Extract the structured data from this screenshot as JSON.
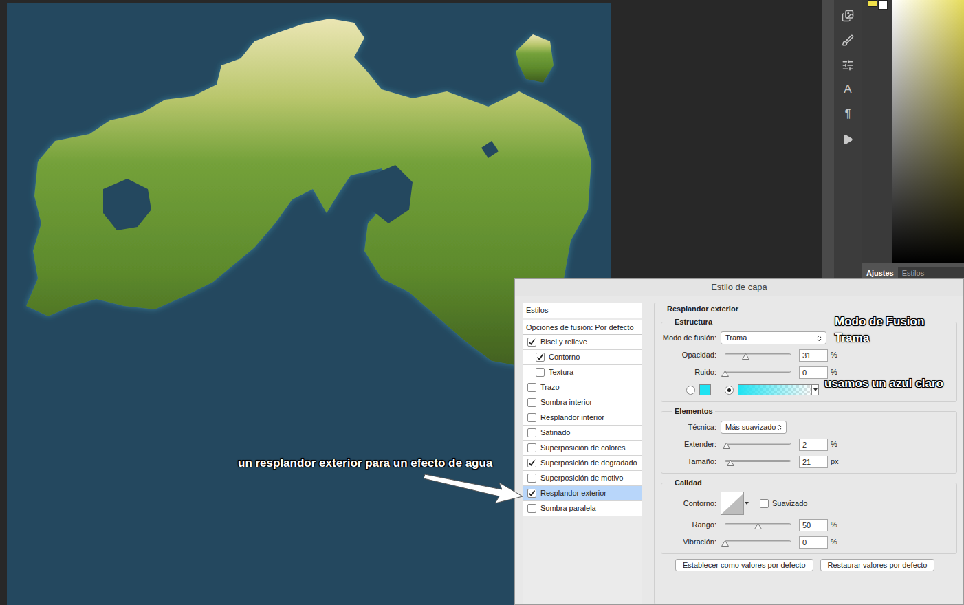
{
  "annotations": {
    "arrow_note": "un resplandor exterior para un efecto de agua",
    "blend_note": [
      "Modo de Fusion",
      "Trama"
    ],
    "color_note": "usamos un azul claro"
  },
  "tools": [
    {
      "kind": "library"
    },
    {
      "kind": "brush"
    },
    {
      "kind": "adjust"
    },
    {
      "kind": "glyph",
      "glyph": "A"
    },
    {
      "kind": "glyph",
      "glyph": "¶"
    },
    {
      "kind": "play"
    }
  ],
  "right_panel": {
    "tabs": [
      {
        "label": "Ajustes",
        "selected": true
      },
      {
        "label": "Estilos",
        "selected": false
      }
    ]
  },
  "dialog": {
    "title": "Estilo de capa",
    "styles_header": "Estilos",
    "blend_options": "Opciones de fusión: Por defecto",
    "styles": [
      {
        "label": "Bisel y relieve",
        "checked": true,
        "kind": "main",
        "selected": false
      },
      {
        "label": "Contorno",
        "checked": true,
        "kind": "sub",
        "selected": false
      },
      {
        "label": "Textura",
        "checked": false,
        "kind": "sub",
        "selected": false
      },
      {
        "label": "Trazo",
        "checked": false,
        "kind": "main",
        "selected": false
      },
      {
        "label": "Sombra interior",
        "checked": false,
        "kind": "main",
        "selected": false
      },
      {
        "label": "Resplandor interior",
        "checked": false,
        "kind": "main",
        "selected": false
      },
      {
        "label": "Satinado",
        "checked": false,
        "kind": "main",
        "selected": false
      },
      {
        "label": "Superposición de colores",
        "checked": false,
        "kind": "main",
        "selected": false
      },
      {
        "label": "Superposición de degradado",
        "checked": true,
        "kind": "main",
        "selected": false
      },
      {
        "label": "Superposición de motivo",
        "checked": false,
        "kind": "main",
        "selected": false
      },
      {
        "label": "Resplandor exterior",
        "checked": true,
        "kind": "main",
        "selected": true
      },
      {
        "label": "Sombra paralela",
        "checked": false,
        "kind": "main",
        "selected": false
      }
    ],
    "section_title": "Resplandor exterior",
    "structure": {
      "title": "Estructura",
      "blend_mode": {
        "label": "Modo de fusión:",
        "value": "Trama"
      },
      "sliders": [
        {
          "label": "Opacidad:",
          "value": "31",
          "unit": "%",
          "level": 0.31
        },
        {
          "label": "Ruido:",
          "value": "0",
          "unit": "%",
          "level": 0
        }
      ],
      "color_option": {
        "selected": false,
        "color": "#1fe3f2"
      },
      "gradient_option": {
        "selected": true,
        "color": "#1fe3f2"
      }
    },
    "elements": {
      "title": "Elementos",
      "technique": {
        "label": "Técnica:",
        "value": "Más suavizado"
      },
      "sliders": [
        {
          "label": "Extender:",
          "value": "2",
          "unit": "%",
          "level": 0.02
        },
        {
          "label": "Tamaño:",
          "value": "21",
          "unit": "px",
          "level": 0.084
        }
      ]
    },
    "quality": {
      "title": "Calidad",
      "contour_label": "Contorno:",
      "antialias": {
        "label": "Suavizado",
        "checked": false
      },
      "sliders": [
        {
          "label": "Rango:",
          "value": "50",
          "unit": "%",
          "level": 0.5
        },
        {
          "label": "Vibración:",
          "value": "0",
          "unit": "%",
          "level": 0
        }
      ]
    },
    "buttons": [
      "Establecer como valores por defecto",
      "Restaurar valores por defecto"
    ]
  }
}
